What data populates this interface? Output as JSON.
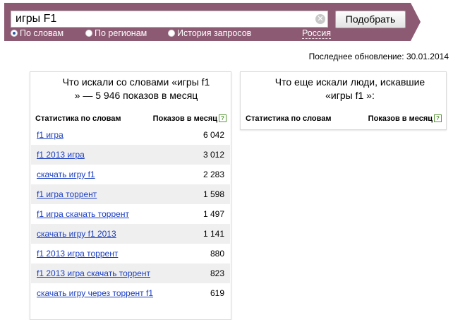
{
  "search": {
    "query": "игры F1",
    "button_label": "Подобрать",
    "clear_symbol": "✕",
    "modes": [
      {
        "label": "По словам",
        "selected": true
      },
      {
        "label": "По регионам",
        "selected": false
      },
      {
        "label": "История запросов",
        "selected": false
      }
    ],
    "region": "Россия"
  },
  "last_update": "Последнее обновление: 30.01.2014",
  "left_panel": {
    "title_line1": "Что искали со словами «игры f1",
    "title_line2": "» — 5 946 показов в месяц",
    "col_words": "Статистика по словам",
    "col_shows": "Показов в месяц",
    "help": "?",
    "rows": [
      {
        "phrase": "f1 игра",
        "count": "6 042"
      },
      {
        "phrase": "f1 2013 игра",
        "count": "3 012"
      },
      {
        "phrase": "скачать игру f1",
        "count": "2 283"
      },
      {
        "phrase": "f1 игра торрент",
        "count": "1 598"
      },
      {
        "phrase": "f1 игра скачать торрент",
        "count": "1 497"
      },
      {
        "phrase": "скачать игру f1 2013",
        "count": "1 141"
      },
      {
        "phrase": "f1 2013 игра торрент",
        "count": "880"
      },
      {
        "phrase": "f1 2013 игра скачать торрент",
        "count": "823"
      },
      {
        "phrase": "скачать игру через торрент f1",
        "count": "619"
      }
    ]
  },
  "right_panel": {
    "title_line1": "Что еще искали люди, искавшие",
    "title_line2": "«игры f1 »:",
    "col_words": "Статистика по словам",
    "col_shows": "Показов в месяц",
    "help": "?"
  },
  "colors": {
    "band": "#8c5a73",
    "link": "#1a3dc1",
    "row_alt": "#efefef"
  }
}
